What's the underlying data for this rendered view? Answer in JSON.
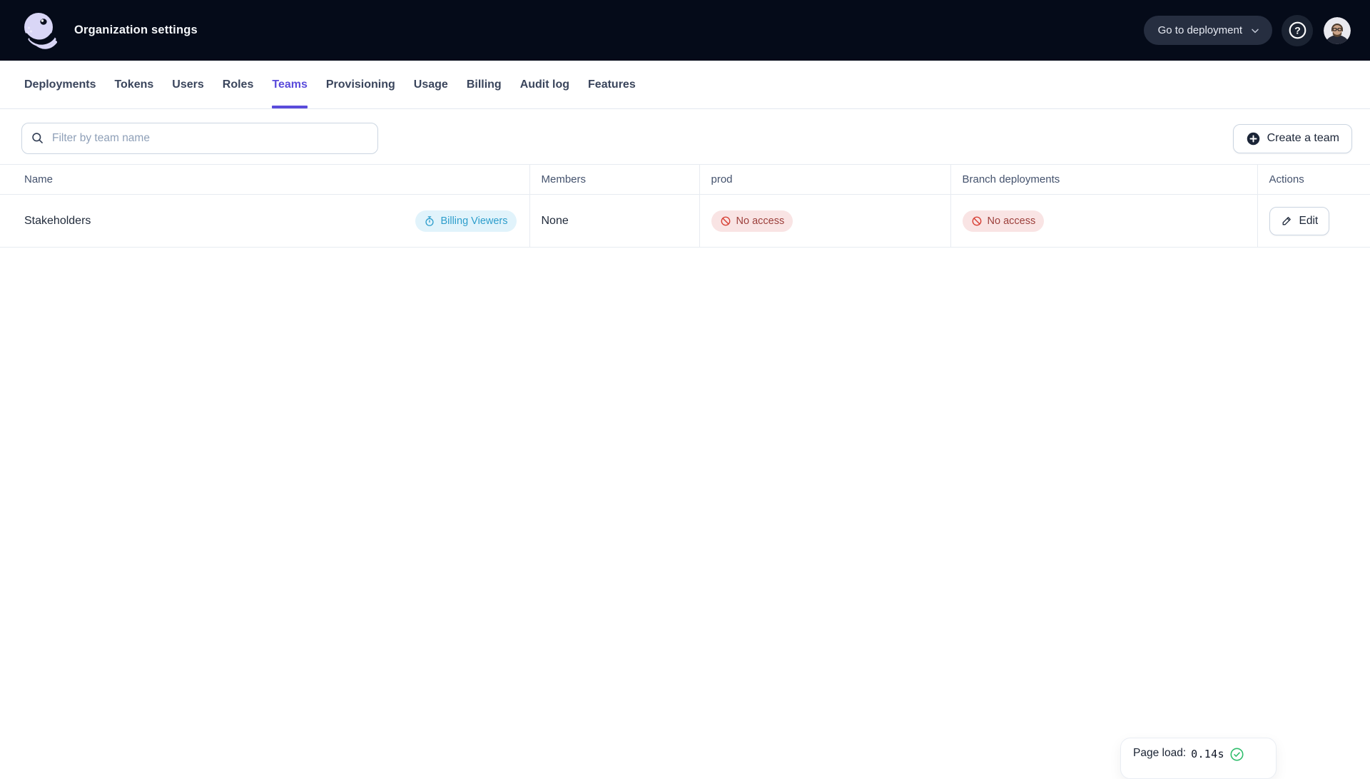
{
  "header": {
    "title": "Organization settings",
    "go_to_deployment_label": "Go to deployment"
  },
  "nav": {
    "tabs": [
      {
        "label": "Deployments",
        "active": false
      },
      {
        "label": "Tokens",
        "active": false
      },
      {
        "label": "Users",
        "active": false
      },
      {
        "label": "Roles",
        "active": false
      },
      {
        "label": "Teams",
        "active": true
      },
      {
        "label": "Provisioning",
        "active": false
      },
      {
        "label": "Usage",
        "active": false
      },
      {
        "label": "Billing",
        "active": false
      },
      {
        "label": "Audit log",
        "active": false
      },
      {
        "label": "Features",
        "active": false
      }
    ]
  },
  "toolbar": {
    "filter_placeholder": "Filter by team name",
    "create_team_label": "Create a team"
  },
  "table": {
    "columns": [
      "Name",
      "Members",
      "prod",
      "Branch deployments",
      "Actions"
    ],
    "rows": [
      {
        "name": "Stakeholders",
        "role_badge": "Billing Viewers",
        "members": "None",
        "prod_access": "No access",
        "branch_access": "No access",
        "edit_label": "Edit"
      }
    ]
  },
  "status_toast": {
    "page_load_label": "Page load:",
    "page_load_value": "0.14s"
  },
  "colors": {
    "topbar_bg": "#050B19",
    "accent_indigo": "#5A4BDB",
    "badge_blue_bg": "#E1F3FB",
    "badge_blue_text": "#2E9ECC",
    "badge_red_bg": "#F9E4E4",
    "badge_red_text": "#9C3F3B",
    "badge_red_icon": "#D63A2F",
    "success_green": "#2EBD6B",
    "logo_lavender": "#D9D6F6"
  }
}
